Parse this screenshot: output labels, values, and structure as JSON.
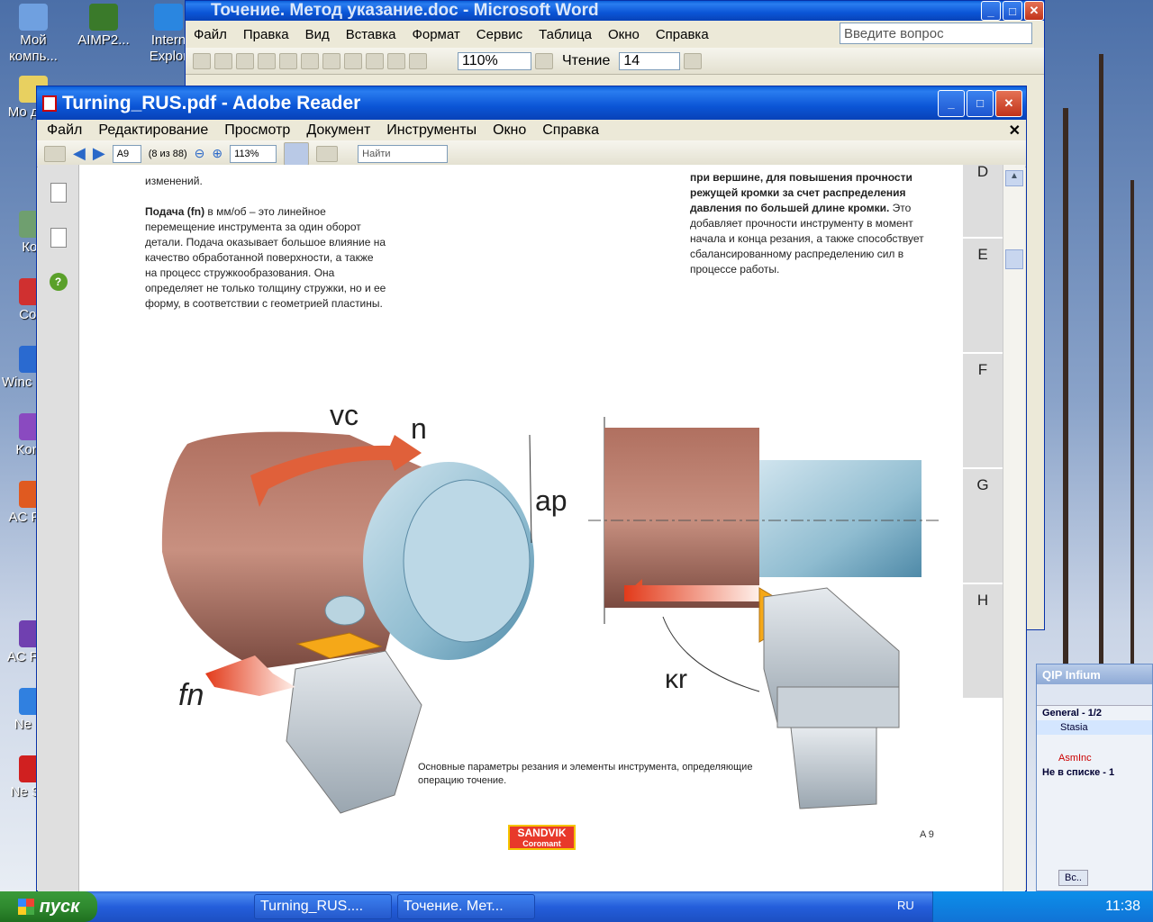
{
  "desktop": {
    "icons": [
      {
        "label": "Мой компь...",
        "color": "#6fa0e0"
      },
      {
        "label": "AIMP2...",
        "color": "#3a7a2a"
      },
      {
        "label": "Intern Explor",
        "color": "#2a86e0"
      },
      {
        "label": "Мо доку",
        "color": "#e8d060"
      },
      {
        "label": "Кор",
        "color": "#6f9f6f"
      },
      {
        "label": "Corc",
        "color": "#d03030"
      },
      {
        "label": "Winc Medi",
        "color": "#2a6ad0"
      },
      {
        "label": "Komp",
        "color": "#8a4ac0"
      },
      {
        "label": "AC Foto",
        "color": "#e05a20"
      },
      {
        "label": "AC Fotol",
        "color": "#7040b0"
      },
      {
        "label": "Ne Ho",
        "color": "#3080e0"
      },
      {
        "label": "Ne Star",
        "color": "#d02020"
      }
    ]
  },
  "word": {
    "title": "Точение. Метод указание.doc - Microsoft Word",
    "menu": [
      "Файл",
      "Правка",
      "Вид",
      "Вставка",
      "Формат",
      "Сервис",
      "Таблица",
      "Окно",
      "Справка"
    ],
    "ask_placeholder": "Введите вопрос",
    "zoom": "110%",
    "reading": "Чтение",
    "font_size": "14"
  },
  "reader": {
    "title": "Turning_RUS.pdf - Adobe Reader",
    "menu": [
      "Файл",
      "Редактирование",
      "Просмотр",
      "Документ",
      "Инструменты",
      "Окно",
      "Справка"
    ],
    "page_field": "A9",
    "page_count": "(8 из 88)",
    "zoom": "113%",
    "find_placeholder": "Найти"
  },
  "doc": {
    "para1_end": "изменений.",
    "para2_bold": "Подача (fn)",
    "para2_rest": " в мм/об – это линейное перемещение инструмента за один оборот детали. Подача оказывает большое влияние на качество обработанной поверхности, а также на процесс стружкообразования. Она определяет не только толщину стружки, но и ее форму, в соответствии с геометрией пластины.",
    "right_bold": "при вершине, для повышения прочности режущей кромки за счет распределения давления по большей длине кромки.",
    "right_rest": " Это добавляет прочности инструменту в момент начала и конца резания, а также способствует сбалансированному распределению сил в процессе работы.",
    "caption": "Основные параметры резания и элементы инструмента, определяющие операцию точение.",
    "labels": {
      "vc": "vc",
      "n": "n",
      "ap": "ap",
      "fn": "fn",
      "kr": "κr"
    },
    "logo_top": "SANDVIK",
    "logo_bottom": "Coromant",
    "page_number": "A 9",
    "tabs": [
      "D",
      "E",
      "F",
      "G",
      "H"
    ]
  },
  "qip": {
    "title": "QIP Infium",
    "group": "General - 1/2",
    "contact1": "Stasia",
    "contact2": "AsmInc",
    "group2": "Не в списке - 1",
    "btn": "Вс.."
  },
  "taskbar": {
    "start": "пуск",
    "item1": "Turning_RUS....",
    "item2": "Точение. Мет...",
    "lang": "RU",
    "clock": "11:38"
  }
}
